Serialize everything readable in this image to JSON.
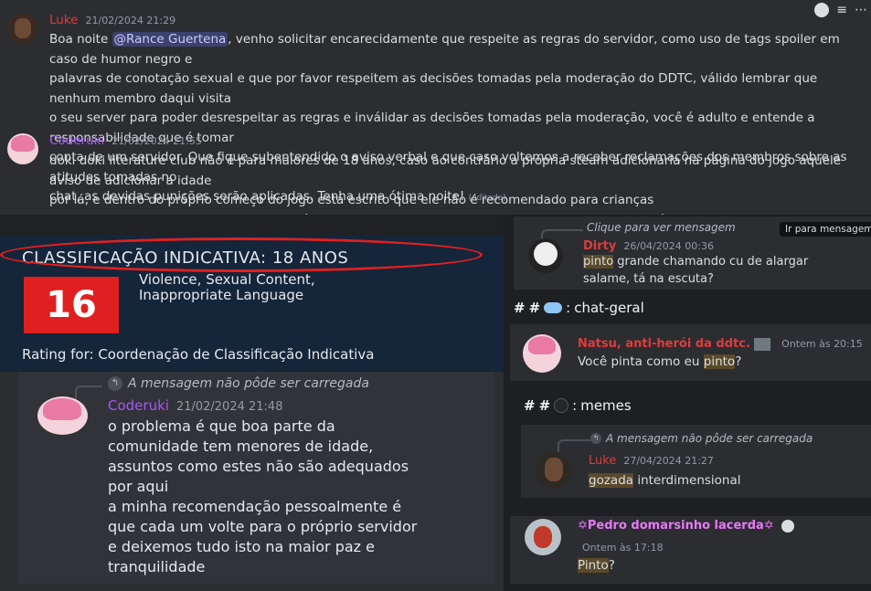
{
  "top_messages": [
    {
      "author": "Luke",
      "author_color": "#e03b3b",
      "timestamp": "21/02/2024 21:29",
      "lines_before_mention": "Boa noite ",
      "mention": "@Rance Guertena",
      "line1_rest": ", venho solicitar encarecidamente que respeite as regras do servidor, como uso de tags spoiler em caso de humor negro e",
      "line2": "palavras de conotação sexual e que por favor respeitem as decisões tomadas pela moderação do DDTC, válido lembrar que nenhum membro daqui visita",
      "line3": "o seu server para poder desrespeitar as regras e inválidar as decisões tomadas pela moderação, você é adulto e entende a responsabilidade que é tomar",
      "line4": "conta de um servidor. Que fique subentendido o aviso verbal e que caso voltemos a receber reclamações dos membros sobre as atitudes tomadas no",
      "line5": "chat, as devidas punições serão aplicadas. Tenha uma ótima noite!",
      "edited": "(editado)"
    },
    {
      "author": "Coderuki",
      "author_color": "#a855f7",
      "timestamp": "21/02/2024 21:55",
      "line1": "doki doki literature club não é para maiores de 18 anos, caso ao contrário a própria steam adicionaria na página do jogo aquele aviso de adicionar a idade",
      "line2": "por lá, e dentro do próprio começo do jogo está escrito que ele não é recomendado para crianças",
      "line3": "eu estou dizendo que a maior parte do público que consome ddlc são adolescentes, o que não está fora da restrição de idade do jogo"
    }
  ],
  "rating_card": {
    "title": "CLASSIFICAÇÃO INDICATIVA: 18 ANOS",
    "badge": "16",
    "descriptors_line1": "Violence, Sexual Content,",
    "descriptors_line2": "Inappropriate Language",
    "footer": "Rating for: Coordenação de Classificação Indicativa"
  },
  "big_message": {
    "reply_text": "A mensagem não pôde ser carregada",
    "author": "Coderuki",
    "timestamp": "21/02/2024 21:48",
    "lines": [
      "o problema é que boa parte da",
      "comunidade tem menores de idade,",
      "assuntos como estes não são adequados",
      "por aqui",
      "a minha recomendação pessoalmente é",
      "que cada um volte para o próprio servidor",
      "e deixemos tudo isto na maior paz e",
      "tranquilidade"
    ]
  },
  "right_top": {
    "reply_preview": "Clique para ver mensagem",
    "tooltip": "Ir para mensagem",
    "author": "Dirty",
    "timestamp": "26/04/2024 00:36",
    "line1_hl": "pinto",
    "line1_rest": " grande chamando cu de alargar",
    "line2": "salame, tá na escuta?"
  },
  "chat_geral": {
    "channel": "chat-geral",
    "author": "Natsu, anti-herói da ddtc.",
    "timestamp": "Ontem às 20:15",
    "text_before": "Você pinta como eu ",
    "text_hl": "pinto",
    "text_after": "?"
  },
  "memes": {
    "channel": "memes",
    "reply_text": "A mensagem não pôde ser carregada",
    "author": "Luke",
    "timestamp": "27/04/2024 21:27",
    "text_hl": "gozada",
    "text_rest": " interdimensional"
  },
  "pedro": {
    "author": "✡Pedro domarsinho lacerda✡",
    "timestamp": "Ontem às 17:18",
    "text_hl": "Pinto",
    "text_rest": "?"
  },
  "icons": [
    "emoji-icon",
    "reaction-icon",
    "more-icon",
    "reply-arrow-icon",
    "hash-icon"
  ],
  "colors": {
    "mention_bg": "#3c4270",
    "highlight_bg": "#5a4a2a",
    "rating_red": "#e02020"
  }
}
